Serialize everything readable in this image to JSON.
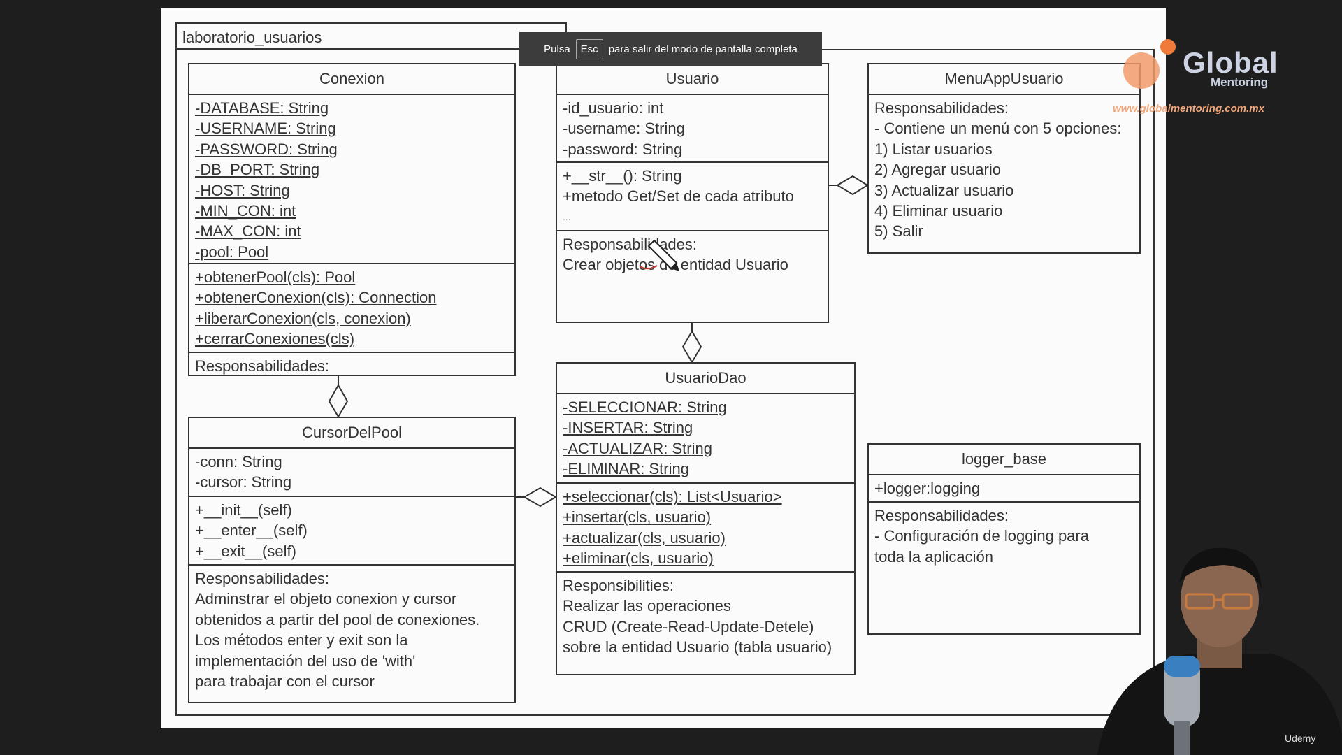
{
  "package": {
    "name": "laboratorio_usuarios"
  },
  "classes": {
    "conexion": {
      "name": "Conexion",
      "attributes": [
        "-DATABASE: String",
        "-USERNAME: String",
        "-PASSWORD: String",
        "-DB_PORT: String",
        "-HOST: String",
        "-MIN_CON: int",
        "-MAX_CON: int",
        "-pool: Pool"
      ],
      "methods": [
        "+obtenerPool(cls): Pool",
        "+obtenerConexion(cls): Connection",
        "+liberarConexion(cls, conexion)",
        "+cerrarConexiones(cls)"
      ],
      "notes": [
        "Responsabilidades:"
      ]
    },
    "cursor": {
      "name": "CursorDelPool",
      "attributes": [
        "-conn: String",
        "-cursor: String"
      ],
      "methods": [
        "+__init__(self)",
        "+__enter__(self)",
        "+__exit__(self)"
      ],
      "notes": [
        "Responsabilidades:",
        "Adminstrar el objeto conexion y cursor",
        "obtenidos a partir del pool de conexiones.",
        "Los métodos enter y exit son la",
        "implementación del uso de 'with'",
        "para trabajar con el cursor"
      ]
    },
    "usuario": {
      "name": "Usuario",
      "attributes": [
        "-id_usuario: int",
        "-username: String",
        "-password: String"
      ],
      "methods": [
        "+__str__(): String",
        "+metodo Get/Set de cada atributo",
        "..."
      ],
      "notes": [
        "Responsabilidades:",
        "Crear objetos de entidad Usuario"
      ]
    },
    "usuarioDao": {
      "name": "UsuarioDao",
      "attributes": [
        "-SELECCIONAR: String",
        "-INSERTAR: String",
        "-ACTUALIZAR: String",
        "-ELIMINAR: String"
      ],
      "methods": [
        "+seleccionar(cls): List<Usuario>",
        "+insertar(cls, usuario)",
        "+actualizar(cls, usuario)",
        "+eliminar(cls, usuario)"
      ],
      "notes": [
        "Responsibilities:",
        "Realizar las operaciones",
        "CRUD (Create-Read-Update-Detele)",
        "sobre la entidad Usuario (tabla usuario)"
      ]
    },
    "menu": {
      "name": "MenuAppUsuario",
      "notes": [
        "Responsabilidades:",
        "- Contiene un menú con 5 opciones:",
        "1) Listar usuarios",
        "2) Agregar usuario",
        "3) Actualizar usuario",
        "4) Eliminar usuario",
        "5) Salir"
      ]
    },
    "logger": {
      "name": "logger_base",
      "attributes": [
        "+logger:logging"
      ],
      "notes": [
        "Responsabilidades:",
        "- Configuración de logging para",
        "toda la aplicación"
      ]
    }
  },
  "fullscreen_banner": {
    "before": "Pulsa",
    "key": "Esc",
    "after": "para salir del modo de pantalla completa"
  },
  "logo": {
    "brand": "Global",
    "sub": "Mentoring",
    "url": "www.globalmentoring.com.mx"
  },
  "watermark": "Udemy",
  "colors": {
    "line": "#333333",
    "sheet": "#fbfbfb",
    "background": "#1e1e1e",
    "logo_accent": "#ef7a3a"
  }
}
